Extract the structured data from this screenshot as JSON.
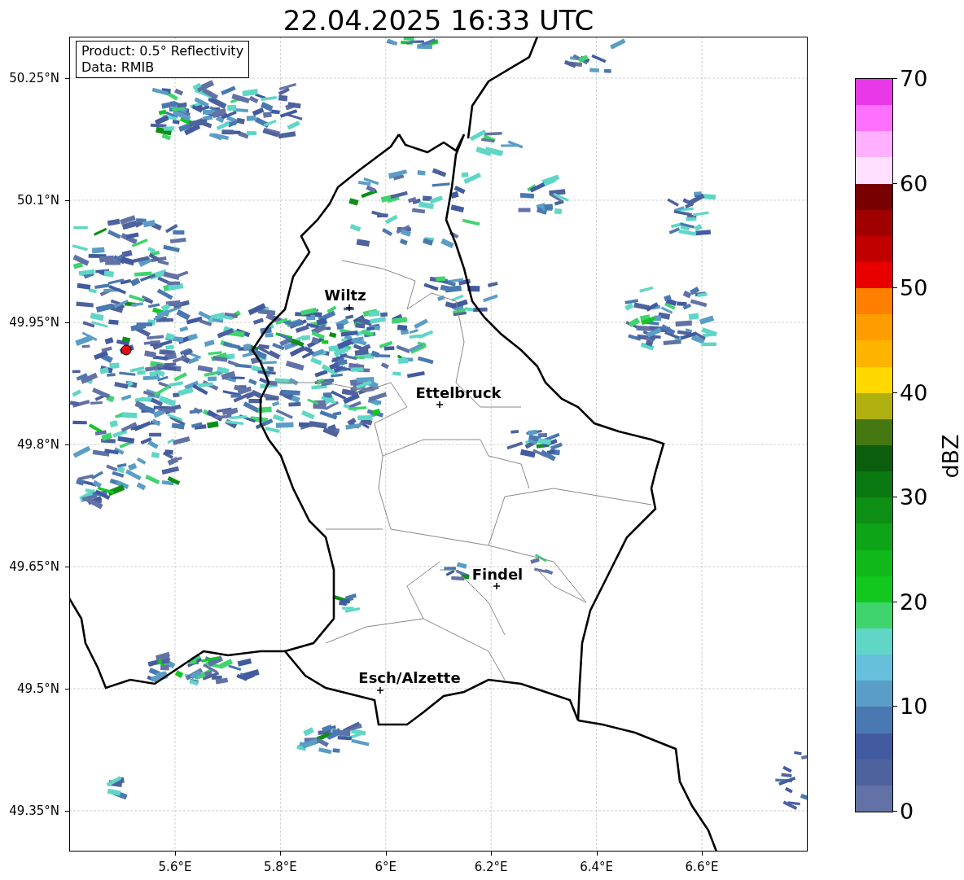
{
  "title": "22.04.2025 16:33 UTC",
  "info_box": [
    "Product: 0.5° Reflectivity",
    "Data: RMIB"
  ],
  "map": {
    "lat_labels": [
      "50.25°N",
      "50.1°N",
      "49.95°N",
      "49.8°N",
      "49.65°N",
      "49.5°N",
      "49.35°N"
    ],
    "lon_labels": [
      "5.6°E",
      "5.8°E",
      "6°E",
      "6.2°E",
      "6.4°E",
      "6.6°E"
    ],
    "cities": [
      {
        "name": "Wiltz"
      },
      {
        "name": "Ettelbruck"
      },
      {
        "name": "Findel"
      },
      {
        "name": "Esch/Alzette"
      }
    ]
  },
  "colorbar": {
    "label": "dBZ",
    "ticks": [
      "70",
      "60",
      "50",
      "40",
      "30",
      "20",
      "10",
      "0"
    ],
    "segments": [
      {
        "color": "#6272a6"
      },
      {
        "color": "#4e629e"
      },
      {
        "color": "#425ba0"
      },
      {
        "color": "#4a78b0"
      },
      {
        "color": "#5a9dc6"
      },
      {
        "color": "#66c0db"
      },
      {
        "color": "#5fd6c6"
      },
      {
        "color": "#3fd46e"
      },
      {
        "color": "#12c81e"
      },
      {
        "color": "#10b81a"
      },
      {
        "color": "#0ea418"
      },
      {
        "color": "#0c8f14"
      },
      {
        "color": "#0a7810"
      },
      {
        "color": "#0a5e0e"
      },
      {
        "color": "#467812"
      },
      {
        "color": "#b0b010"
      },
      {
        "color": "#ffd800"
      },
      {
        "color": "#ffb400"
      },
      {
        "color": "#ff9c00"
      },
      {
        "color": "#ff8000"
      },
      {
        "color": "#e80000"
      },
      {
        "color": "#c00000"
      },
      {
        "color": "#a00000"
      },
      {
        "color": "#780000"
      },
      {
        "color": "#ffe0ff"
      },
      {
        "color": "#ffb0ff"
      },
      {
        "color": "#ff70ff"
      },
      {
        "color": "#e838e8"
      }
    ]
  }
}
